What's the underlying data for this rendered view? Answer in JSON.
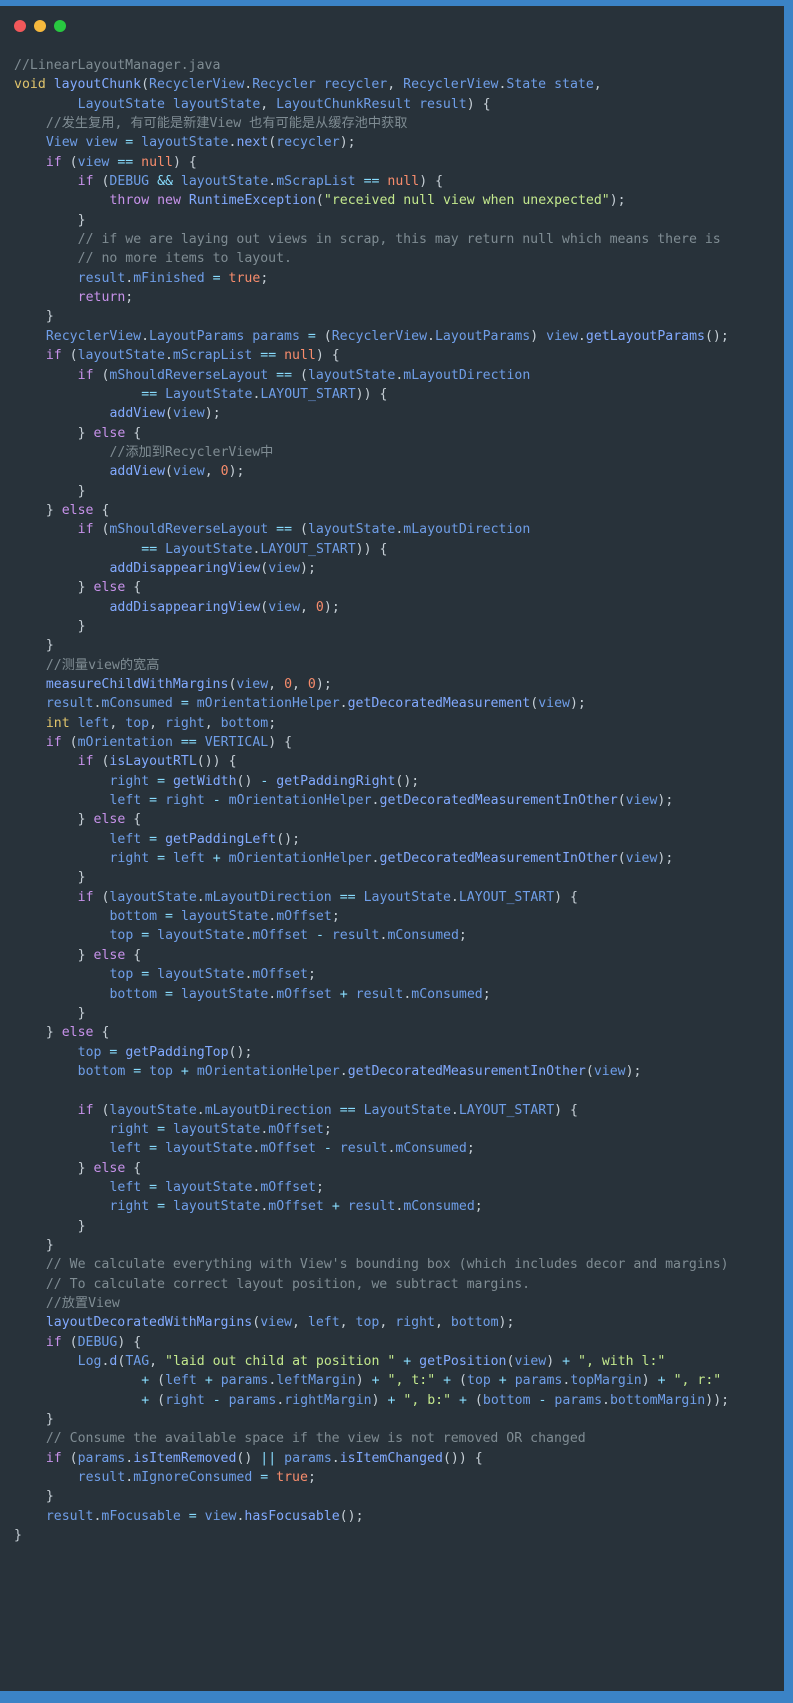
{
  "window": {
    "kind": "code-snippet-window",
    "background_color": "#3b83c6",
    "surface_color": "#28323a",
    "traffic_lights": [
      {
        "name": "close",
        "color": "#f2585a"
      },
      {
        "name": "minimize",
        "color": "#f6b93d"
      },
      {
        "name": "maximize",
        "color": "#28c840"
      }
    ]
  },
  "theme": {
    "comment": "#7f8c93",
    "keyword": "#c792ea",
    "type": "#e0c46c",
    "class": "#6f9ee8",
    "function": "#82aaff",
    "plain": "#c6cfd6",
    "number": "#f78c6c",
    "string": "#c3e88d",
    "operator": "#89ddff"
  },
  "code": {
    "language": "java",
    "source_file": "LinearLayoutManager.java",
    "lines": [
      "//LinearLayoutManager.java",
      "void layoutChunk(RecyclerView.Recycler recycler, RecyclerView.State state,",
      "        LayoutState layoutState, LayoutChunkResult result) {",
      "    //发生复用, 有可能是新建View 也有可能是从缓存池中获取",
      "    View view = layoutState.next(recycler);",
      "    if (view == null) {",
      "        if (DEBUG && layoutState.mScrapList == null) {",
      "            throw new RuntimeException(\"received null view when unexpected\");",
      "        }",
      "        // if we are laying out views in scrap, this may return null which means there is",
      "        // no more items to layout.",
      "        result.mFinished = true;",
      "        return;",
      "    }",
      "    RecyclerView.LayoutParams params = (RecyclerView.LayoutParams) view.getLayoutParams();",
      "    if (layoutState.mScrapList == null) {",
      "        if (mShouldReverseLayout == (layoutState.mLayoutDirection",
      "                == LayoutState.LAYOUT_START)) {",
      "            addView(view);",
      "        } else {",
      "            //添加到RecyclerView中",
      "            addView(view, 0);",
      "        }",
      "    } else {",
      "        if (mShouldReverseLayout == (layoutState.mLayoutDirection",
      "                == LayoutState.LAYOUT_START)) {",
      "            addDisappearingView(view);",
      "        } else {",
      "            addDisappearingView(view, 0);",
      "        }",
      "    }",
      "    //测量view的宽高",
      "    measureChildWithMargins(view, 0, 0);",
      "    result.mConsumed = mOrientationHelper.getDecoratedMeasurement(view);",
      "    int left, top, right, bottom;",
      "    if (mOrientation == VERTICAL) {",
      "        if (isLayoutRTL()) {",
      "            right = getWidth() - getPaddingRight();",
      "            left = right - mOrientationHelper.getDecoratedMeasurementInOther(view);",
      "        } else {",
      "            left = getPaddingLeft();",
      "            right = left + mOrientationHelper.getDecoratedMeasurementInOther(view);",
      "        }",
      "        if (layoutState.mLayoutDirection == LayoutState.LAYOUT_START) {",
      "            bottom = layoutState.mOffset;",
      "            top = layoutState.mOffset - result.mConsumed;",
      "        } else {",
      "            top = layoutState.mOffset;",
      "            bottom = layoutState.mOffset + result.mConsumed;",
      "        }",
      "    } else {",
      "        top = getPaddingTop();",
      "        bottom = top + mOrientationHelper.getDecoratedMeasurementInOther(view);",
      "",
      "        if (layoutState.mLayoutDirection == LayoutState.LAYOUT_START) {",
      "            right = layoutState.mOffset;",
      "            left = layoutState.mOffset - result.mConsumed;",
      "        } else {",
      "            left = layoutState.mOffset;",
      "            right = layoutState.mOffset + result.mConsumed;",
      "        }",
      "    }",
      "    // We calculate everything with View's bounding box (which includes decor and margins)",
      "    // To calculate correct layout position, we subtract margins.",
      "    //放置View",
      "    layoutDecoratedWithMargins(view, left, top, right, bottom);",
      "    if (DEBUG) {",
      "        Log.d(TAG, \"laid out child at position \" + getPosition(view) + \", with l:\"",
      "                + (left + params.leftMargin) + \", t:\" + (top + params.topMargin) + \", r:\"",
      "                + (right - params.rightMargin) + \", b:\" + (bottom - params.bottomMargin));",
      "    }",
      "    // Consume the available space if the view is not removed OR changed",
      "    if (params.isItemRemoved() || params.isItemChanged()) {",
      "        result.mIgnoreConsumed = true;",
      "    }",
      "    result.mFocusable = view.hasFocusable();",
      "}"
    ]
  }
}
